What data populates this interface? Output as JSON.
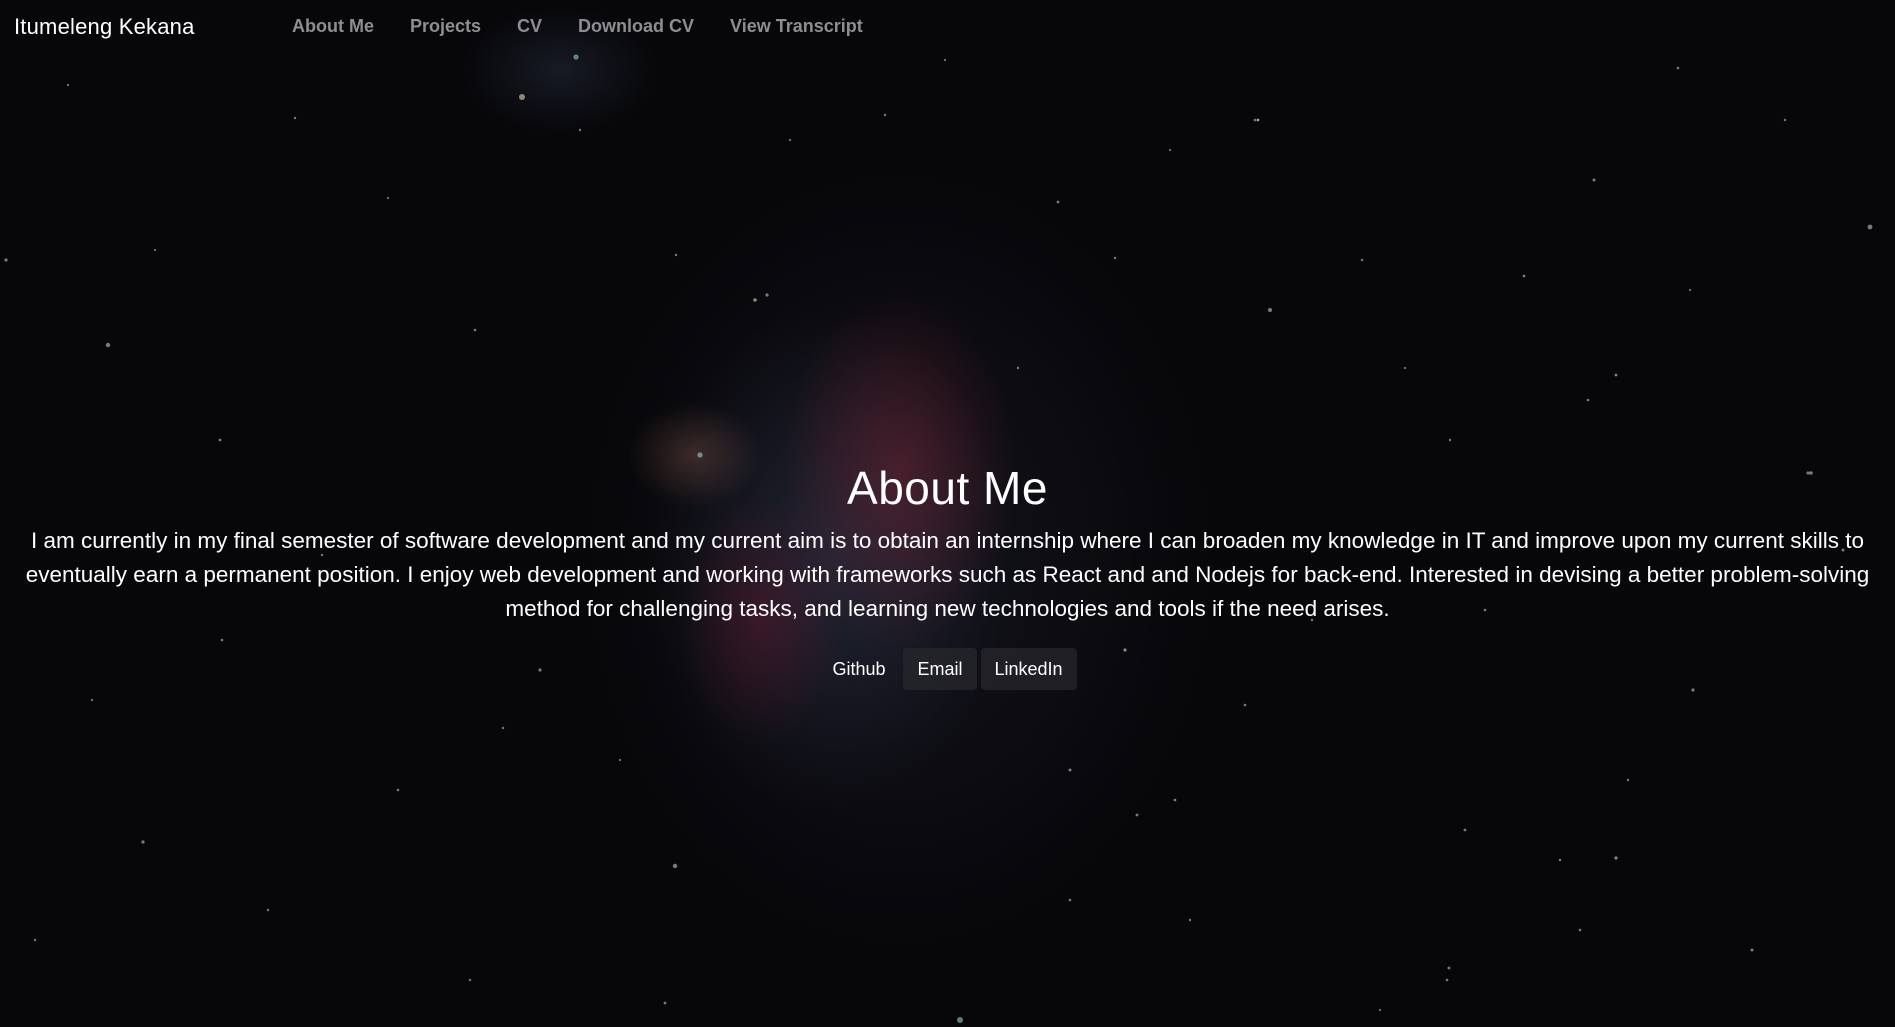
{
  "header": {
    "brand": "Itumeleng Kekana",
    "nav": [
      {
        "label": "About Me"
      },
      {
        "label": "Projects"
      },
      {
        "label": "CV"
      },
      {
        "label": "Download CV"
      },
      {
        "label": "View Transcript"
      }
    ]
  },
  "hero": {
    "title": "About Me",
    "text": "I am currently in my final semester of software development and my current aim is to obtain an internship where I can broaden my knowledge in IT and improve upon my current skills to eventually earn a permanent position. I enjoy web development and working with frameworks such as React and and Nodejs for back-end. Interested in devising a better problem-solving method for challenging tasks, and learning new technologies and tools if the need arises.",
    "buttons": [
      {
        "label": "Github"
      },
      {
        "label": "Email"
      },
      {
        "label": "LinkedIn"
      }
    ]
  },
  "colors": {
    "background": "#07070a",
    "nav_text": "#8e8e92",
    "text": "#ffffff",
    "button_bg": "#28282e"
  }
}
